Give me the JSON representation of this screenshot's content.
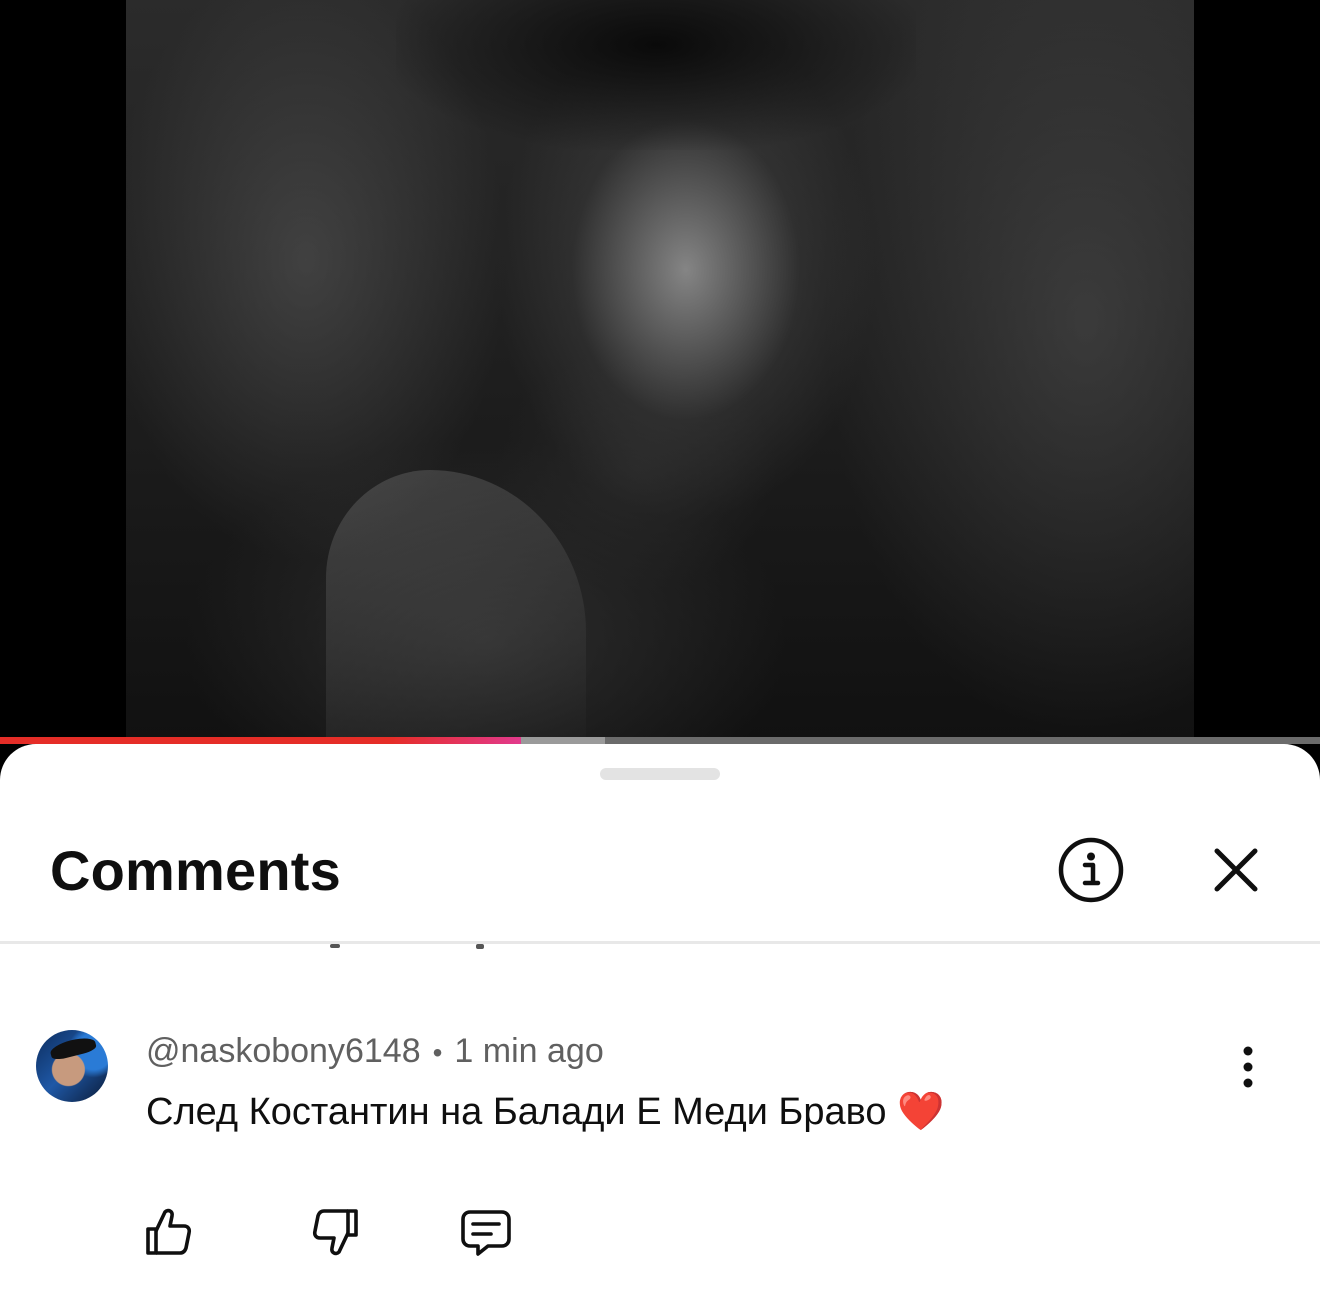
{
  "player": {
    "progress_fraction": 0.395,
    "buffered_fraction": 0.458,
    "played_color": "#e52d27",
    "played_end_color": "#e23a8c"
  },
  "comments_panel": {
    "title": "Comments",
    "info_icon": "info-icon",
    "close_icon": "close-icon"
  },
  "comments": [
    {
      "author": "@naskobony6148",
      "separator": "•",
      "time": "1 min ago",
      "text": "След Костантин на Балади Е Меди Браво ❤️",
      "avatar_icon": "avatar",
      "more_icon": "more-vertical-icon",
      "actions": {
        "like_icon": "thumbs-up-icon",
        "dislike_icon": "thumbs-down-icon",
        "reply_icon": "reply-icon"
      }
    }
  ]
}
